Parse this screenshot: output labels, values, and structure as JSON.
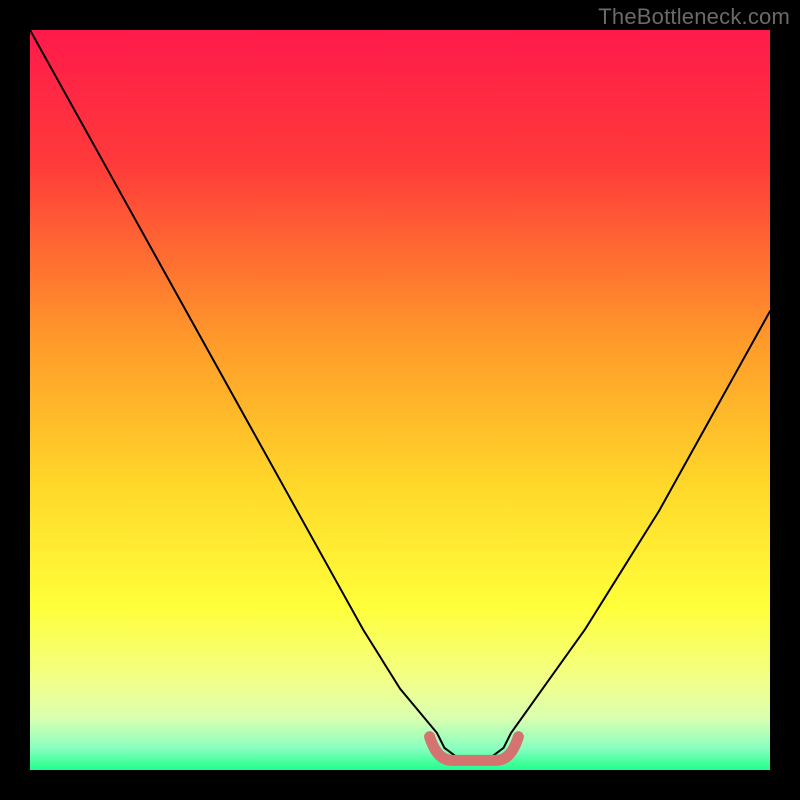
{
  "watermark": "TheBottleneck.com",
  "colors": {
    "gradient_stops": [
      {
        "offset": "0%",
        "color": "#ff1a4b"
      },
      {
        "offset": "18%",
        "color": "#ff3a3a"
      },
      {
        "offset": "42%",
        "color": "#ff9a2a"
      },
      {
        "offset": "62%",
        "color": "#ffd92a"
      },
      {
        "offset": "78%",
        "color": "#ffff3a"
      },
      {
        "offset": "88%",
        "color": "#f2ff8a"
      },
      {
        "offset": "93%",
        "color": "#d9ffb0"
      },
      {
        "offset": "97%",
        "color": "#8affc0"
      },
      {
        "offset": "100%",
        "color": "#20ff8a"
      }
    ],
    "curve_stroke": "#000000",
    "bottom_marker": "#d4736f"
  },
  "chart_data": {
    "type": "line",
    "title": "",
    "xlabel": "",
    "ylabel": "",
    "xlim": [
      0,
      100
    ],
    "ylim": [
      0,
      100
    ],
    "x": [
      0,
      5,
      10,
      15,
      20,
      25,
      30,
      35,
      40,
      45,
      50,
      55,
      56,
      58,
      60,
      62,
      64,
      65,
      70,
      75,
      80,
      85,
      90,
      95,
      100
    ],
    "values": [
      100,
      91,
      82,
      73,
      64,
      55,
      46,
      37,
      28,
      19,
      11,
      5,
      3,
      1.5,
      1,
      1.5,
      3,
      5,
      12,
      19,
      27,
      35,
      44,
      53,
      62
    ],
    "bottom_marker": {
      "x_start": 54,
      "x_end": 66,
      "y": 2.5
    }
  }
}
